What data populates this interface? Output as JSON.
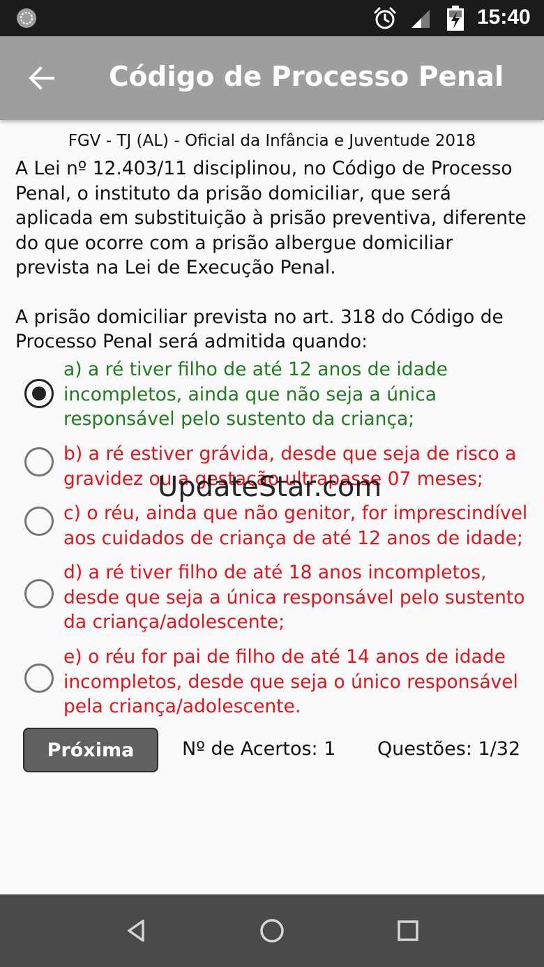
{
  "status_bar": {
    "time": "15:40",
    "icons": [
      "sync-icon",
      "alarm-icon",
      "signal-icon",
      "battery-charging-icon"
    ]
  },
  "app_bar": {
    "title": "Código de Processo Penal",
    "back_icon": "arrow-back-icon"
  },
  "question": {
    "source": "FGV - TJ (AL) - Oficial da Infância e Juventude 2018",
    "paragraph_1": "A Lei nº 12.403/11 disciplinou, no Código de Processo Penal, o instituto da prisão domiciliar, que será aplicada em substituição à prisão preventiva, diferente do que ocorre com a prisão albergue domiciliar prevista na Lei de Execução Penal.",
    "paragraph_2": "A prisão domiciliar prevista no art. 318 do Código de Processo Penal será admitida quando:"
  },
  "options": [
    {
      "label": "a) a ré tiver filho de até 12 anos de idade incompletos, ainda que não seja a única responsável pelo sustento da criança;",
      "state": "correct",
      "selected": true
    },
    {
      "label": "b) a ré estiver grávida, desde que seja de risco a gravidez ou a gestação ultrapasse 07 meses;",
      "state": "wrong",
      "selected": false
    },
    {
      "label": "c) o réu, ainda que não genitor, for imprescindível aos cuidados de criança de até 12 anos de idade;",
      "state": "wrong",
      "selected": false
    },
    {
      "label": "d) a ré tiver filho de até 18 anos incompletos, desde que seja a única responsável pelo sustento da criança/adolescente;",
      "state": "wrong",
      "selected": false
    },
    {
      "label": "e) o réu for pai de filho de até 14 anos de idade incompletos, desde que seja o único responsável pela criança/adolescente.",
      "state": "wrong",
      "selected": false
    }
  ],
  "footer": {
    "next_label": "Próxima",
    "score_text": "Nº de Acertos: 1",
    "count_text": "Questões: 1/32"
  },
  "watermark": "UpdateStar.com",
  "colors": {
    "correct": "#1e7d1e",
    "wrong": "#e3141c",
    "app_bar": "#9e9e9e",
    "status_bar": "#1b1b1b",
    "nav_bar": "#4a4a4a"
  },
  "nav_bar": {
    "icons": [
      "back-triangle-icon",
      "home-circle-icon",
      "recents-square-icon"
    ]
  }
}
